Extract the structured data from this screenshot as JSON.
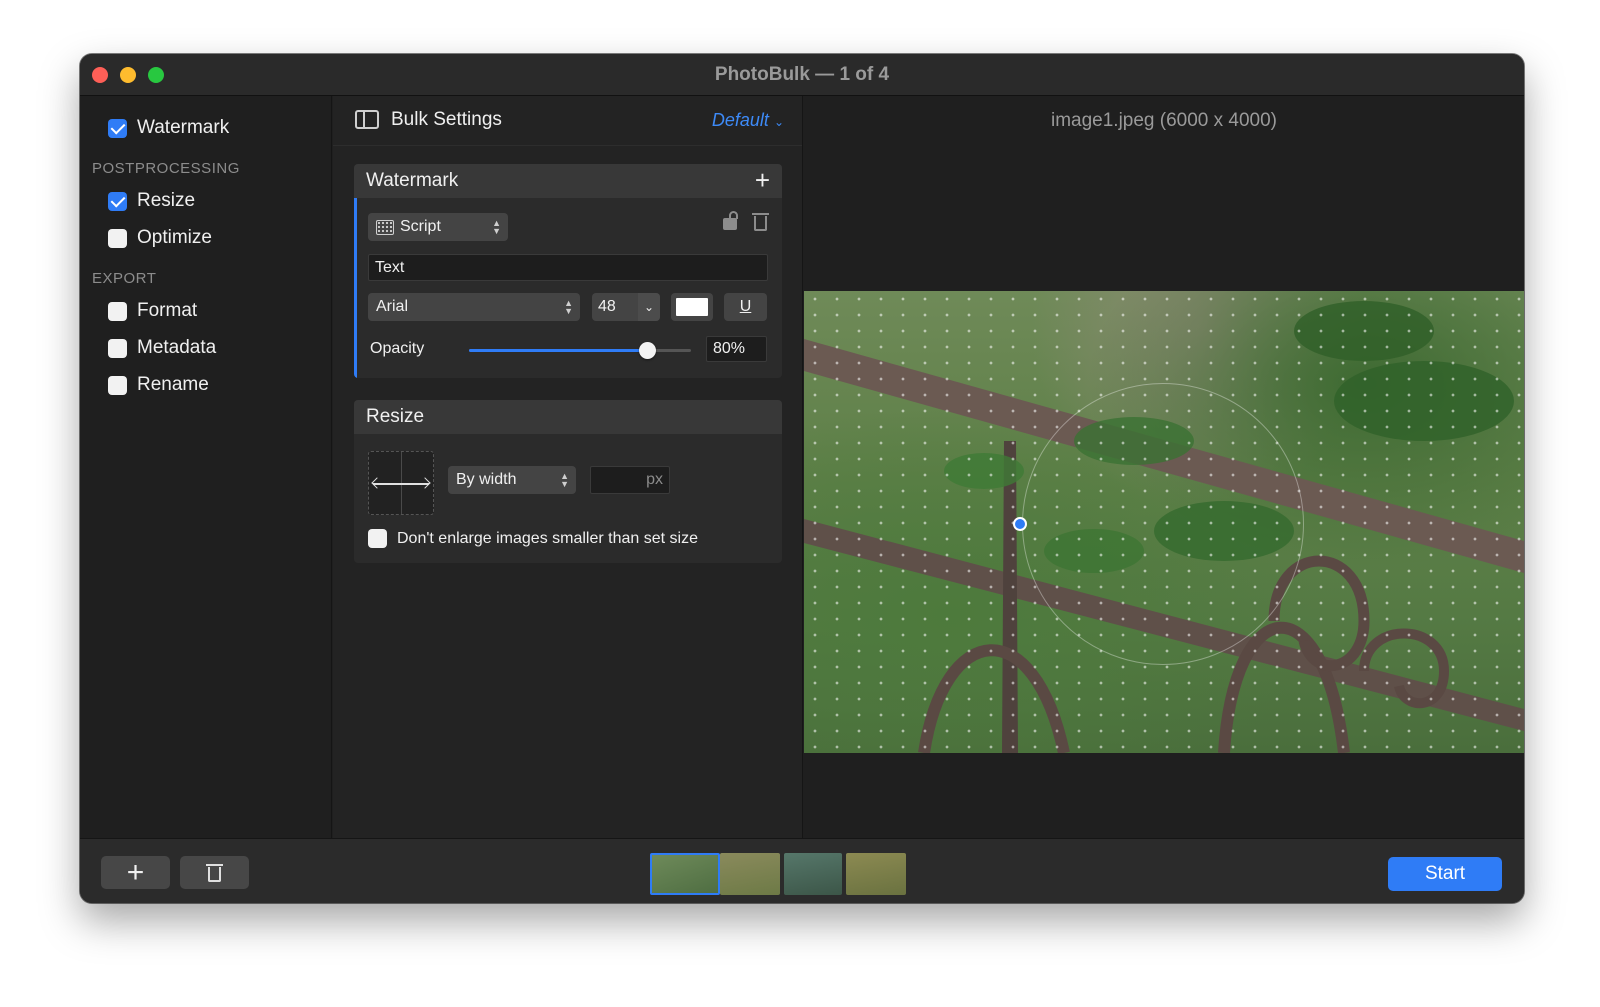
{
  "window": {
    "title": "PhotoBulk — 1 of 4"
  },
  "sidebar": {
    "top_item": {
      "label": "Watermark",
      "checked": true
    },
    "sections": [
      {
        "title": "POSTPROCESSING",
        "items": [
          {
            "label": "Resize",
            "checked": true
          },
          {
            "label": "Optimize",
            "checked": false
          }
        ]
      },
      {
        "title": "EXPORT",
        "items": [
          {
            "label": "Format",
            "checked": false
          },
          {
            "label": "Metadata",
            "checked": false
          },
          {
            "label": "Rename",
            "checked": false
          }
        ]
      }
    ]
  },
  "settings": {
    "title": "Bulk Settings",
    "preset": "Default",
    "watermark": {
      "title": "Watermark",
      "type": "Script",
      "text_value": "Text",
      "font": "Arial",
      "size": "48",
      "color": "#ffffff",
      "underline_label": "U",
      "opacity_label": "Opacity",
      "opacity_value": "80%",
      "opacity_fraction": 0.8
    },
    "resize": {
      "title": "Resize",
      "mode": "By width",
      "unit": "px",
      "no_enlarge_label": "Don't enlarge images smaller than set size",
      "no_enlarge_checked": false
    }
  },
  "preview": {
    "filename": "image1.jpeg (6000 x 4000)"
  },
  "bottom": {
    "start_label": "Start",
    "thumbnail_count": 4,
    "selected_thumbnail": 1
  },
  "colors": {
    "accent": "#2f7cf6",
    "window_bg": "#1f1f1f",
    "panel_bg": "#2b2b2b"
  }
}
